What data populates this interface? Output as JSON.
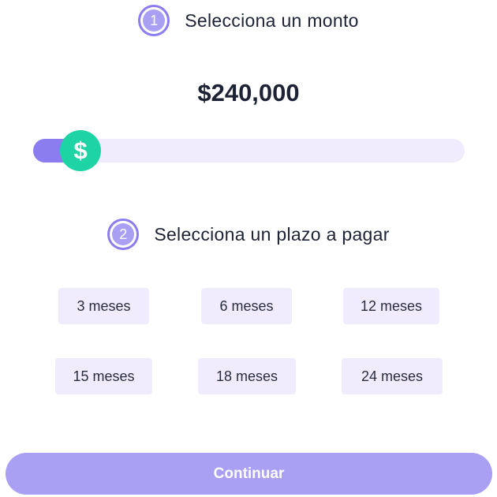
{
  "step1": {
    "number": "1",
    "title": "Selecciona un monto"
  },
  "amount": {
    "display": "$240,000",
    "slider_fraction": 0.11,
    "thumb_icon": "dollar-icon",
    "thumb_symbol": "$"
  },
  "step2": {
    "number": "2",
    "title": "Selecciona un plazo a pagar"
  },
  "terms": [
    "3 meses",
    "6 meses",
    "12 meses",
    "15 meses",
    "18 meses",
    "24 meses"
  ],
  "continue_label": "Continuar",
  "colors": {
    "accent": "#8b7cf0",
    "accent_light": "#a99ff3",
    "thumb": "#1ed3a4",
    "pill_bg": "#f1ecfd",
    "text": "#1e2235"
  }
}
